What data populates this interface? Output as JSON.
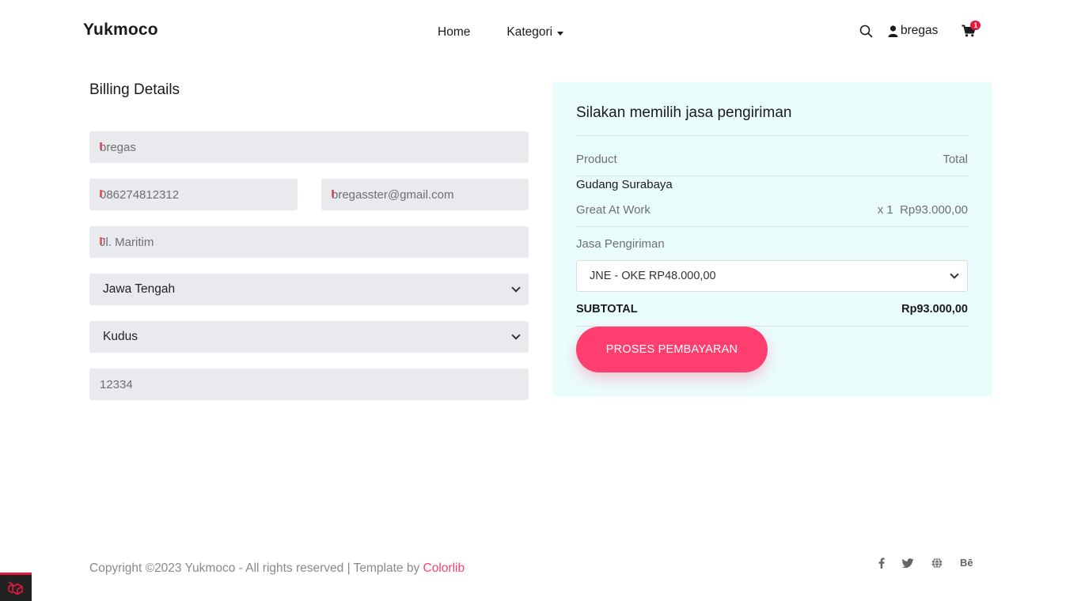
{
  "header": {
    "brand": "Yukmoco",
    "nav": [
      {
        "label": "Home"
      },
      {
        "label": "Kategori"
      }
    ],
    "user": "bregas",
    "cart_count": "1"
  },
  "billing": {
    "title": "Billing Details",
    "name": "bregas",
    "phone": "086274812312",
    "email": "bregasster@gmail.com",
    "address": "Jl. Maritim",
    "province": "Jawa Tengah",
    "city": "Kudus",
    "postal_code": "12334"
  },
  "order": {
    "title": "Silakan memilih jasa pengiriman",
    "col_product": "Product",
    "col_total": "Total",
    "warehouse": "Gudang Surabaya",
    "item_name": "Great At Work",
    "item_qty": "x 1",
    "item_price": "Rp93.000,00",
    "shipping_label": "Jasa Pengiriman",
    "shipping_selected": "JNE - OKE RP48.000,00",
    "subtotal_label": "SUBTOTAL",
    "subtotal_value": "Rp93.000,00",
    "pay_button": "PROSES PEMBAYARAN"
  },
  "footer": {
    "copyright": "Copyright ©2023 Yukmoco - All rights reserved | Template by ",
    "credit": "Colorlib",
    "social": [
      "facebook-icon",
      "twitter-icon",
      "globe-icon",
      "behance-icon"
    ],
    "behance_text": "Bē"
  },
  "colors": {
    "accent": "#fe3e6e",
    "panel_bg": "#eafdfd",
    "field_bg": "#e9eaed"
  }
}
